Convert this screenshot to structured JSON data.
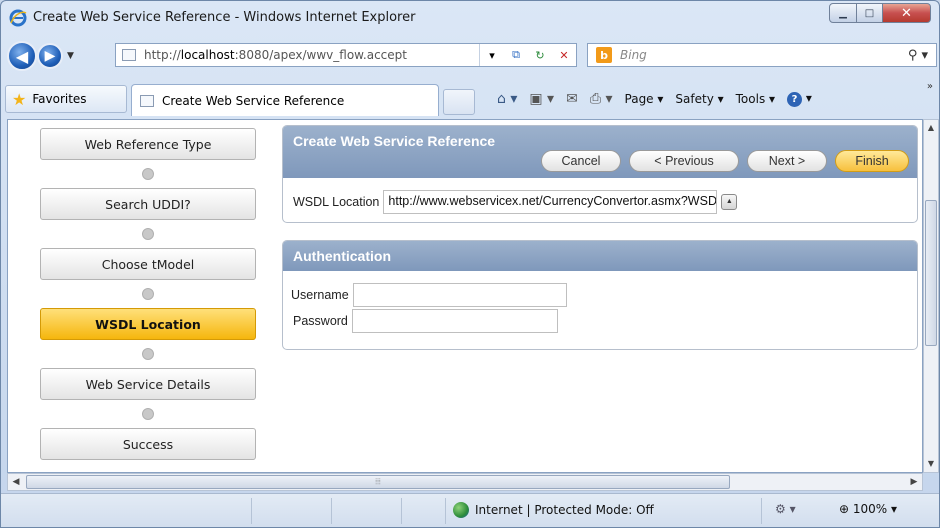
{
  "window": {
    "title": "Create Web Service Reference - Windows Internet Explorer"
  },
  "navbar": {
    "url_prefix": "http://",
    "url_host": "localhost",
    "url_rest": ":8080/apex/wwv_flow.accept",
    "search_placeholder": "Bing"
  },
  "favbar": {
    "favorites_label": "Favorites",
    "tab_title": "Create Web Service Reference",
    "page_label": "Page ▾",
    "safety_label": "Safety ▾",
    "tools_label": "Tools ▾"
  },
  "steps": [
    {
      "label": "Web Reference Type",
      "active": false
    },
    {
      "label": "Search UDDI?",
      "active": false
    },
    {
      "label": "Choose tModel",
      "active": false
    },
    {
      "label": "WSDL Location",
      "active": true
    },
    {
      "label": "Web Service Details",
      "active": false
    },
    {
      "label": "Success",
      "active": false
    }
  ],
  "main_region": {
    "title": "Create Web Service Reference",
    "buttons": {
      "cancel": "Cancel",
      "previous": "< Previous",
      "next": "Next >",
      "finish": "Finish"
    },
    "wsdl_label": "WSDL Location",
    "wsdl_value": "http://www.webservicex.net/CurrencyConvertor.asmx?WSDL"
  },
  "auth_region": {
    "title": "Authentication",
    "username_label": "Username",
    "password_label": "Password",
    "username_value": "",
    "password_value": ""
  },
  "statusbar": {
    "zone_text": "Internet | Protected Mode: Off",
    "zoom": "100%"
  },
  "colors": {
    "active_step": "#f5b60d",
    "region_header": "#8aa0c2",
    "finish_button": "#f7c03d"
  }
}
